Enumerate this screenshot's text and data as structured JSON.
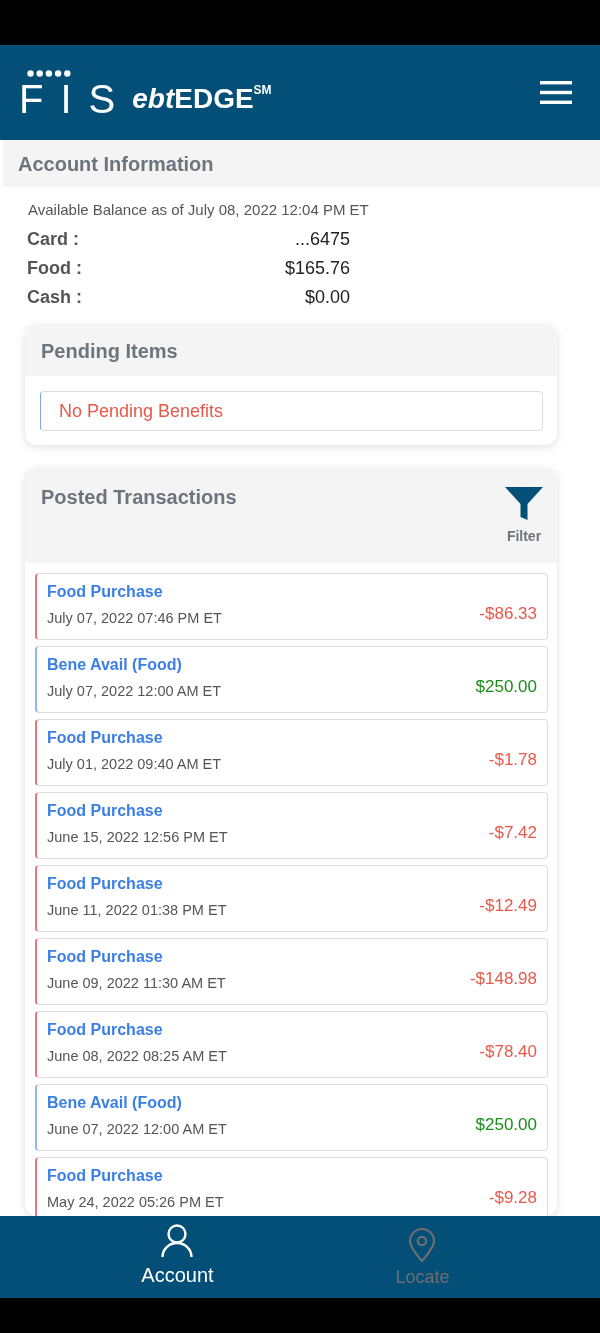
{
  "header": {
    "logo": {
      "brand": "FIS",
      "product_prefix": "ebt",
      "product": "EDGE$^{SM}$"
    }
  },
  "account_information": {
    "title": "Account Information",
    "balance_note": "Available Balance as of July 08, 2022 12:04 PM ET",
    "rows": [
      {
        "label": "Card :",
        "value": "...6475"
      },
      {
        "label": "Food :",
        "value": "$165.76"
      },
      {
        "label": "Cash :",
        "value": "$0.00"
      }
    ]
  },
  "pending_items": {
    "title": "Pending Items",
    "message": "No Pending Benefits"
  },
  "posted_transactions": {
    "title": "Posted Transactions",
    "filter_label": "Filter",
    "transactions": [
      {
        "kind": "debit",
        "title": "Food Purchase",
        "date": "July 07, 2022 07:46 PM ET",
        "amount": "-$86.33"
      },
      {
        "kind": "credit",
        "title": "Bene Avail (Food)",
        "date": "July 07, 2022 12:00 AM ET",
        "amount": "$250.00"
      },
      {
        "kind": "debit",
        "title": "Food Purchase",
        "date": "July 01, 2022 09:40 AM ET",
        "amount": "-$1.78"
      },
      {
        "kind": "debit",
        "title": "Food Purchase",
        "date": "June 15, 2022 12:56 PM ET",
        "amount": "-$7.42"
      },
      {
        "kind": "debit",
        "title": "Food Purchase",
        "date": "June 11, 2022 01:38 PM ET",
        "amount": "-$12.49"
      },
      {
        "kind": "debit",
        "title": "Food Purchase",
        "date": "June 09, 2022 11:30 AM ET",
        "amount": "-$148.98"
      },
      {
        "kind": "debit",
        "title": "Food Purchase",
        "date": "June 08, 2022 08:25 AM ET",
        "amount": "-$78.40"
      },
      {
        "kind": "credit",
        "title": "Bene Avail (Food)",
        "date": "June 07, 2022 12:00 AM ET",
        "amount": "$250.00"
      },
      {
        "kind": "debit",
        "title": "Food Purchase",
        "date": "May 24, 2022 05:26 PM ET",
        "amount": "-$9.28"
      }
    ]
  },
  "bottom_nav": [
    {
      "kind": "account",
      "label": "Account",
      "selected": true
    },
    {
      "kind": "locate",
      "label": "Locate",
      "selected": false
    }
  ]
}
